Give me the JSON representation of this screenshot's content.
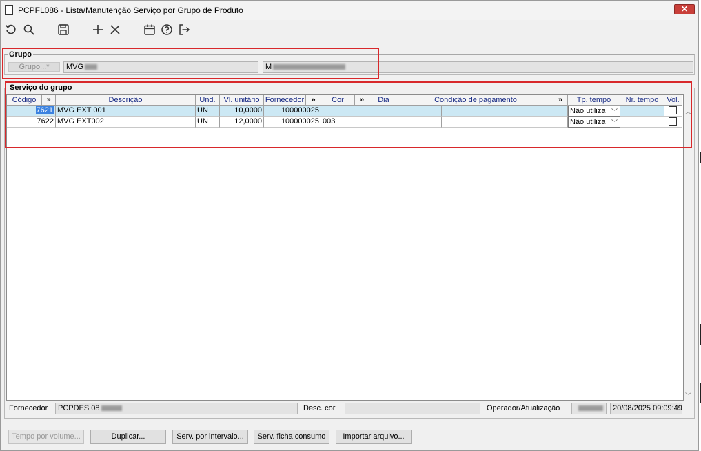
{
  "window": {
    "title": "PCPFL086 - Lista/Manutenção Serviço por Grupo de Produto",
    "close_label": "✕"
  },
  "toolbar": {
    "icons": [
      "undo-icon",
      "search-icon",
      "save-icon",
      "add-icon",
      "delete-icon",
      "calendar-icon",
      "help-icon",
      "exit-icon"
    ]
  },
  "grupo": {
    "legend": "Grupo",
    "button_label": "Grupo...*",
    "code_value": "MVG",
    "description_value": "M"
  },
  "servico": {
    "legend": "Serviço do grupo",
    "columns": {
      "codigo": "Código",
      "expand1": "»",
      "descricao": "Descrição",
      "und": "Und.",
      "vl_unitario": "Vl. unitário",
      "fornecedor": "Fornecedor",
      "expand2": "»",
      "cor": "Cor",
      "expand3": "»",
      "dia": "Dia",
      "condicao": "Condição de pagamento",
      "expand4": "»",
      "tp_tempo": "Tp. tempo",
      "nr_tempo": "Nr. tempo",
      "vol": "Vol."
    },
    "rows": [
      {
        "codigo": "7621",
        "descricao": "MVG EXT 001",
        "und": "UN",
        "vl_unitario": "10,0000",
        "fornecedor": "100000025",
        "cor": "",
        "tp_tempo": "Não utiliza",
        "vol": false
      },
      {
        "codigo": "7622",
        "descricao": "MVG EXT002",
        "und": "UN",
        "vl_unitario": "12,0000",
        "fornecedor": "100000025",
        "cor": "003",
        "tp_tempo": "Não utiliza",
        "vol": false
      }
    ]
  },
  "footer_fields": {
    "fornecedor_label": "Fornecedor",
    "fornecedor_value": "PCPDES 08",
    "desc_cor_label": "Desc. cor",
    "desc_cor_value": "",
    "operador_label": "Operador/Atualização",
    "operador_value": "",
    "atualizacao_value": "20/08/2025 09:09:49"
  },
  "buttons": {
    "tempo_por_volume": "Tempo por volume...",
    "duplicar": "Duplicar...",
    "serv_por_intervalo": "Serv. por intervalo...",
    "serv_ficha_consumo": "Serv. ficha consumo",
    "importar_arquivo": "Importar arquivo..."
  },
  "colors": {
    "highlight_box": "#d8282b",
    "selected_row": "#cce8f4",
    "selection": "#3b82e0",
    "header_text": "#1a2c86"
  }
}
